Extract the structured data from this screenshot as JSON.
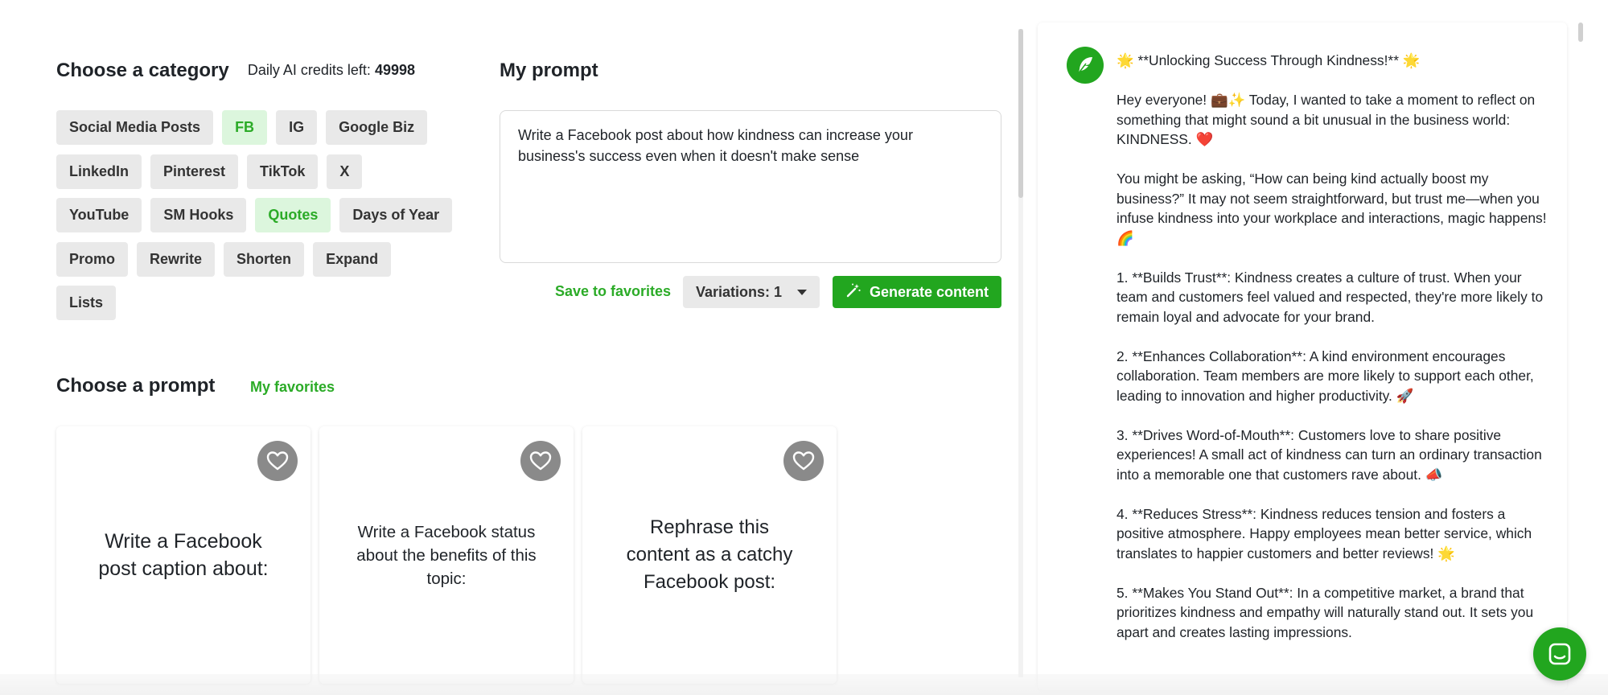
{
  "category": {
    "title": "Choose a category",
    "rows": [
      [
        {
          "label": "Social Media Posts",
          "active": false
        },
        {
          "label": "FB",
          "active": true
        },
        {
          "label": "IG",
          "active": false
        },
        {
          "label": "Google Biz",
          "active": false
        }
      ],
      [
        {
          "label": "LinkedIn",
          "active": false
        },
        {
          "label": "Pinterest",
          "active": false
        },
        {
          "label": "TikTok",
          "active": false
        },
        {
          "label": "X",
          "active": false
        }
      ],
      [
        {
          "label": "YouTube",
          "active": false
        },
        {
          "label": "SM Hooks",
          "active": false
        },
        {
          "label": "Quotes",
          "active": true
        },
        {
          "label": "Days of Year",
          "active": false
        }
      ],
      [
        {
          "label": "Promo",
          "active": false
        },
        {
          "label": "Rewrite",
          "active": false
        },
        {
          "label": "Shorten",
          "active": false
        },
        {
          "label": "Expand",
          "active": false
        }
      ],
      [
        {
          "label": "Lists",
          "active": false
        }
      ]
    ]
  },
  "prompt": {
    "title": "My prompt",
    "credits_label": "Daily AI credits left:",
    "credits_value": "49998",
    "text": "Write a Facebook post about how kindness can increase your business's success even when it doesn't make sense",
    "save_label": "Save to favorites",
    "variations_label": "Variations: 1",
    "generate_label": "Generate content"
  },
  "choose_prompt": {
    "title": "Choose a prompt",
    "favorites_link": "My favorites",
    "cards": [
      {
        "text": "Write a Facebook post caption about:"
      },
      {
        "text": "Write a Facebook status about the benefits of this topic:"
      },
      {
        "text": "Rephrase this content as a catchy Facebook post:"
      }
    ]
  },
  "output": {
    "paragraphs": [
      "🌟 **Unlocking Success Through Kindness!** 🌟",
      "Hey everyone! 💼✨ Today, I wanted to take a moment to reflect on something that might sound a bit unusual in the business world: KINDNESS. ❤️",
      "You might be asking, “How can being kind actually boost my business?” It may not seem straightforward, but trust me—when you infuse kindness into your workplace and interactions, magic happens! 🌈",
      "1. **Builds Trust**: Kindness creates a culture of trust. When your team and customers feel valued and respected, they're more likely to remain loyal and advocate for your brand.",
      "2. **Enhances Collaboration**: A kind environment encourages collaboration. Team members are more likely to support each other, leading to innovation and higher productivity. 🚀",
      "3. **Drives Word-of-Mouth**: Customers love to share positive experiences! A small act of kindness can turn an ordinary transaction into a memorable one that customers rave about. 📣",
      "4. **Reduces Stress**: Kindness reduces tension and fosters a positive atmosphere. Happy employees mean better service, which translates to happier customers and better reviews! 🌟",
      "5. **Makes You Stand Out**: In a competitive market, a brand that prioritizes kindness and empathy will naturally stand out. It sets you apart and creates lasting impressions."
    ]
  },
  "colors": {
    "accent": "#22a61f",
    "chip_bg": "#e9e9e9",
    "chip_active_bg": "#dcf6dd",
    "heart_bg": "#8a8a8a"
  },
  "icons": {
    "generate": "magic-wand-icon",
    "heart": "heart-icon",
    "avatar": "feather-icon",
    "chat": "chat-icon"
  }
}
